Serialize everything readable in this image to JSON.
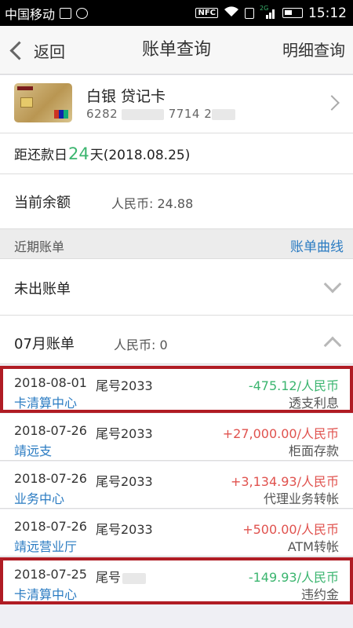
{
  "status_bar": {
    "carrier": "中国移动",
    "net_label": "2G",
    "nfc": "NFC",
    "time": "15:12"
  },
  "nav": {
    "back_label": "返回",
    "title": "账单查询",
    "right_label": "明细查询"
  },
  "card": {
    "name": "白银 贷记卡",
    "number_prefix": "6282",
    "number_mid": "7714",
    "number_suffix": "2"
  },
  "due": {
    "prefix": "距还款日",
    "days": "24",
    "suffix": "天(2018.08.25)"
  },
  "balance": {
    "label": "当前余额",
    "value": "人民币: 24.88"
  },
  "recent": {
    "label": "近期账单",
    "curve_link": "账单曲线"
  },
  "unbilled": {
    "label": "未出账单"
  },
  "month": {
    "label": "07月账单",
    "value": "人民币: 0"
  },
  "transactions": [
    {
      "date": "2018-08-01",
      "tail": "尾号2033",
      "merchant": "卡清算中心",
      "amount": "-475.12/人民币",
      "type": "透支利息",
      "sign": "neg",
      "highlighted": true
    },
    {
      "date": "2018-07-26",
      "tail": "尾号2033",
      "merchant": "靖远支",
      "amount": "+27,000.00/人民币",
      "type": "柜面存款",
      "sign": "pos",
      "highlighted": false
    },
    {
      "date": "2018-07-26",
      "tail": "尾号2033",
      "merchant": "业务中心",
      "amount": "+3,134.93/人民币",
      "type": "代理业务转帐",
      "sign": "pos",
      "highlighted": false
    },
    {
      "date": "2018-07-26",
      "tail": "尾号2033",
      "merchant": "靖远营业厅",
      "amount": "+500.00/人民币",
      "type": "ATM转帐",
      "sign": "pos",
      "highlighted": false
    },
    {
      "date": "2018-07-25",
      "tail": "尾号",
      "merchant": "卡清算中心",
      "amount": "-149.93/人民币",
      "type": "违约金",
      "sign": "neg",
      "highlighted": true
    }
  ],
  "colors": {
    "accent_blue": "#2a7bc2",
    "negative_green": "#3bb56f",
    "positive_red": "#e0524e",
    "highlight_red": "#b01c24"
  }
}
